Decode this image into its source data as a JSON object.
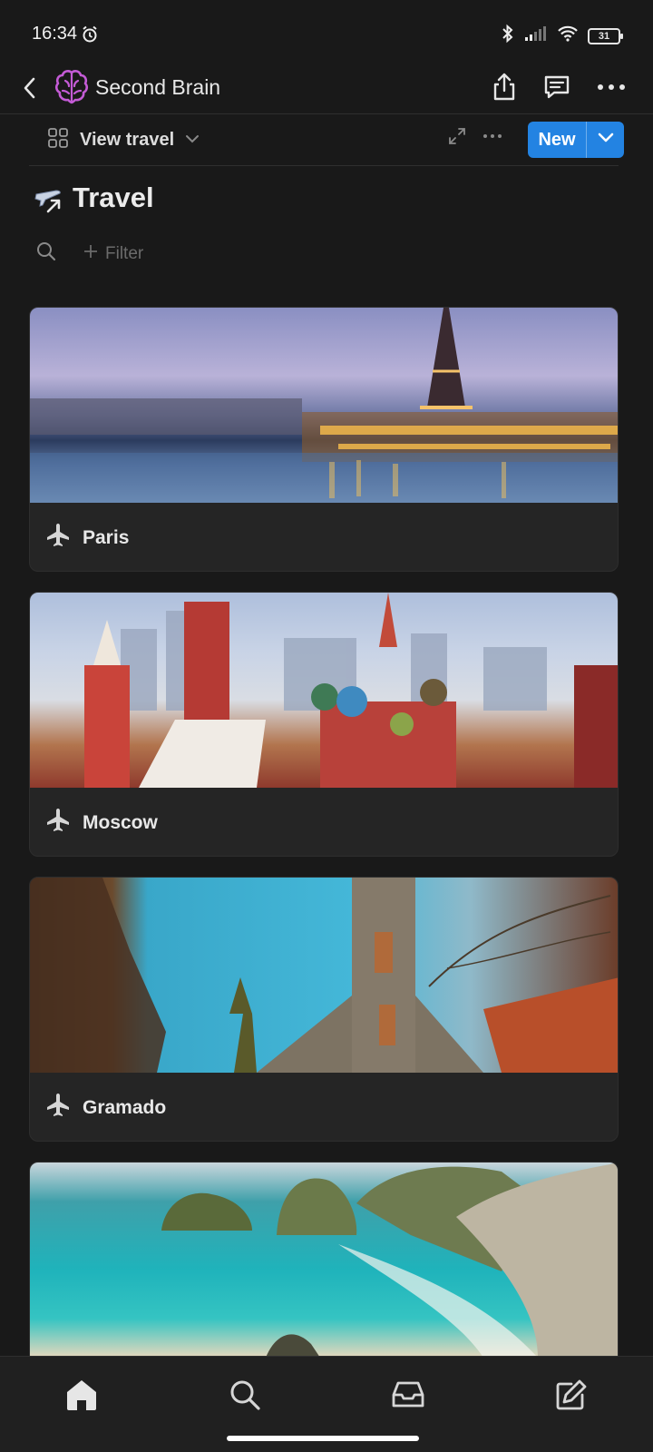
{
  "status_bar": {
    "time": "16:34",
    "battery_level": "31",
    "icons": [
      "alarm-icon",
      "bluetooth-icon",
      "signal-icon",
      "wifi-icon",
      "battery-icon"
    ]
  },
  "header": {
    "title": "Second Brain",
    "icons": [
      "back-icon",
      "brain-icon",
      "share-icon",
      "comment-icon",
      "more-icon"
    ]
  },
  "view_bar": {
    "view_label": "View travel",
    "new_label": "New",
    "accent_color": "#2383e2"
  },
  "page": {
    "title": "Travel",
    "filter_label": "Filter"
  },
  "cards": [
    {
      "name": "Paris"
    },
    {
      "name": "Moscow"
    },
    {
      "name": "Gramado"
    }
  ],
  "bottom_nav": {
    "items": [
      "home-icon",
      "search-icon",
      "inbox-icon",
      "compose-icon"
    ]
  }
}
